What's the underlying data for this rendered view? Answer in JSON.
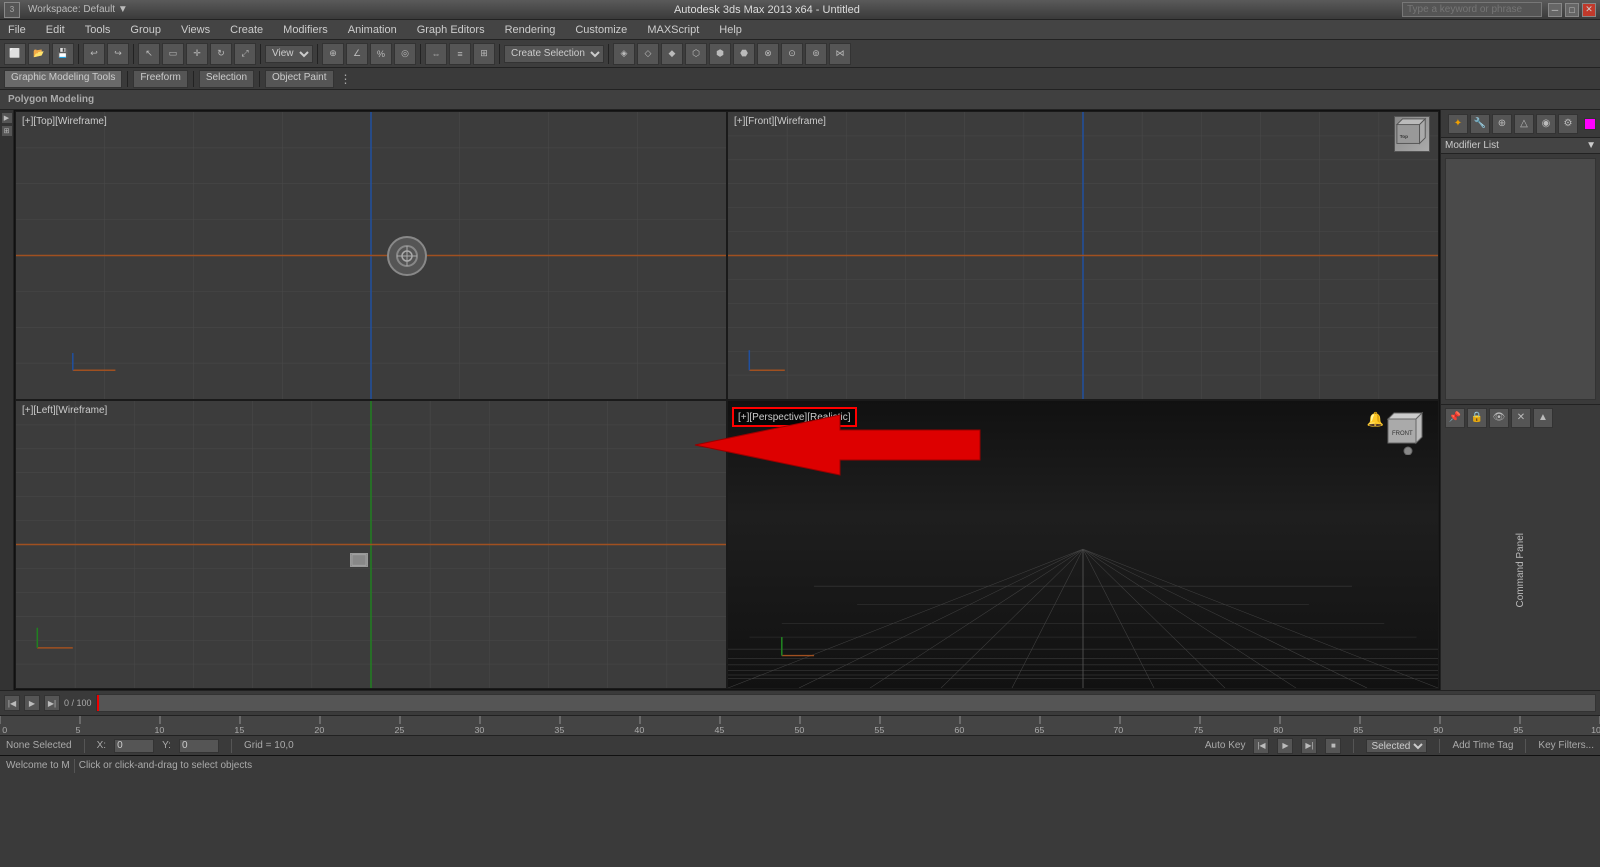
{
  "app": {
    "title": "Autodesk 3ds Max 2013 x64 - Untitled",
    "search_placeholder": "Type a keyword or phrase"
  },
  "titlebar": {
    "minimize": "─",
    "maximize": "□",
    "close": "✕",
    "workspace": "Workspace: Default"
  },
  "menu": {
    "items": [
      "File",
      "Edit",
      "Tools",
      "Group",
      "Views",
      "Create",
      "Modifiers",
      "Animation",
      "Graph Editors",
      "Rendering",
      "Customize",
      "MAXScript",
      "Help"
    ]
  },
  "toolbar2": {
    "tabs": [
      "Graphic Modeling Tools",
      "Freeform",
      "Selection",
      "Object Paint"
    ]
  },
  "toolbar3": {
    "label": "Polygon Modeling"
  },
  "viewports": {
    "top_left": {
      "label": "[+][Top][Wireframe]"
    },
    "top_right": {
      "label": "[+][Front][Wireframe]"
    },
    "bottom_left": {
      "label": "[+][Left][Wireframe]"
    },
    "bottom_right": {
      "label": "[+][Perspective][Realistic]"
    }
  },
  "right_panel": {
    "modifier_list_label": "Modifier List"
  },
  "command_panel": {
    "label": "Command Panel"
  },
  "timeline": {
    "current": "0",
    "total": "100",
    "label": "0 / 100"
  },
  "statusbar": {
    "selected": "None Selected",
    "x_label": "X:",
    "y_label": "Y:",
    "grid_label": "Grid = 10,0",
    "autokey_label": "Auto Key",
    "selected_mode": "Selected",
    "time_tag_label": "Add Time Tag",
    "key_filters_label": "Key Filters...",
    "info": "Click or click-and-drag to select objects"
  },
  "colors": {
    "background": "#3a3a3a",
    "viewport_bg": "#3c3c3c",
    "persp_bg_top": "#1a1a1a",
    "grid": "#4a4a4a",
    "accent_red": "#e00",
    "text": "#cccccc"
  }
}
